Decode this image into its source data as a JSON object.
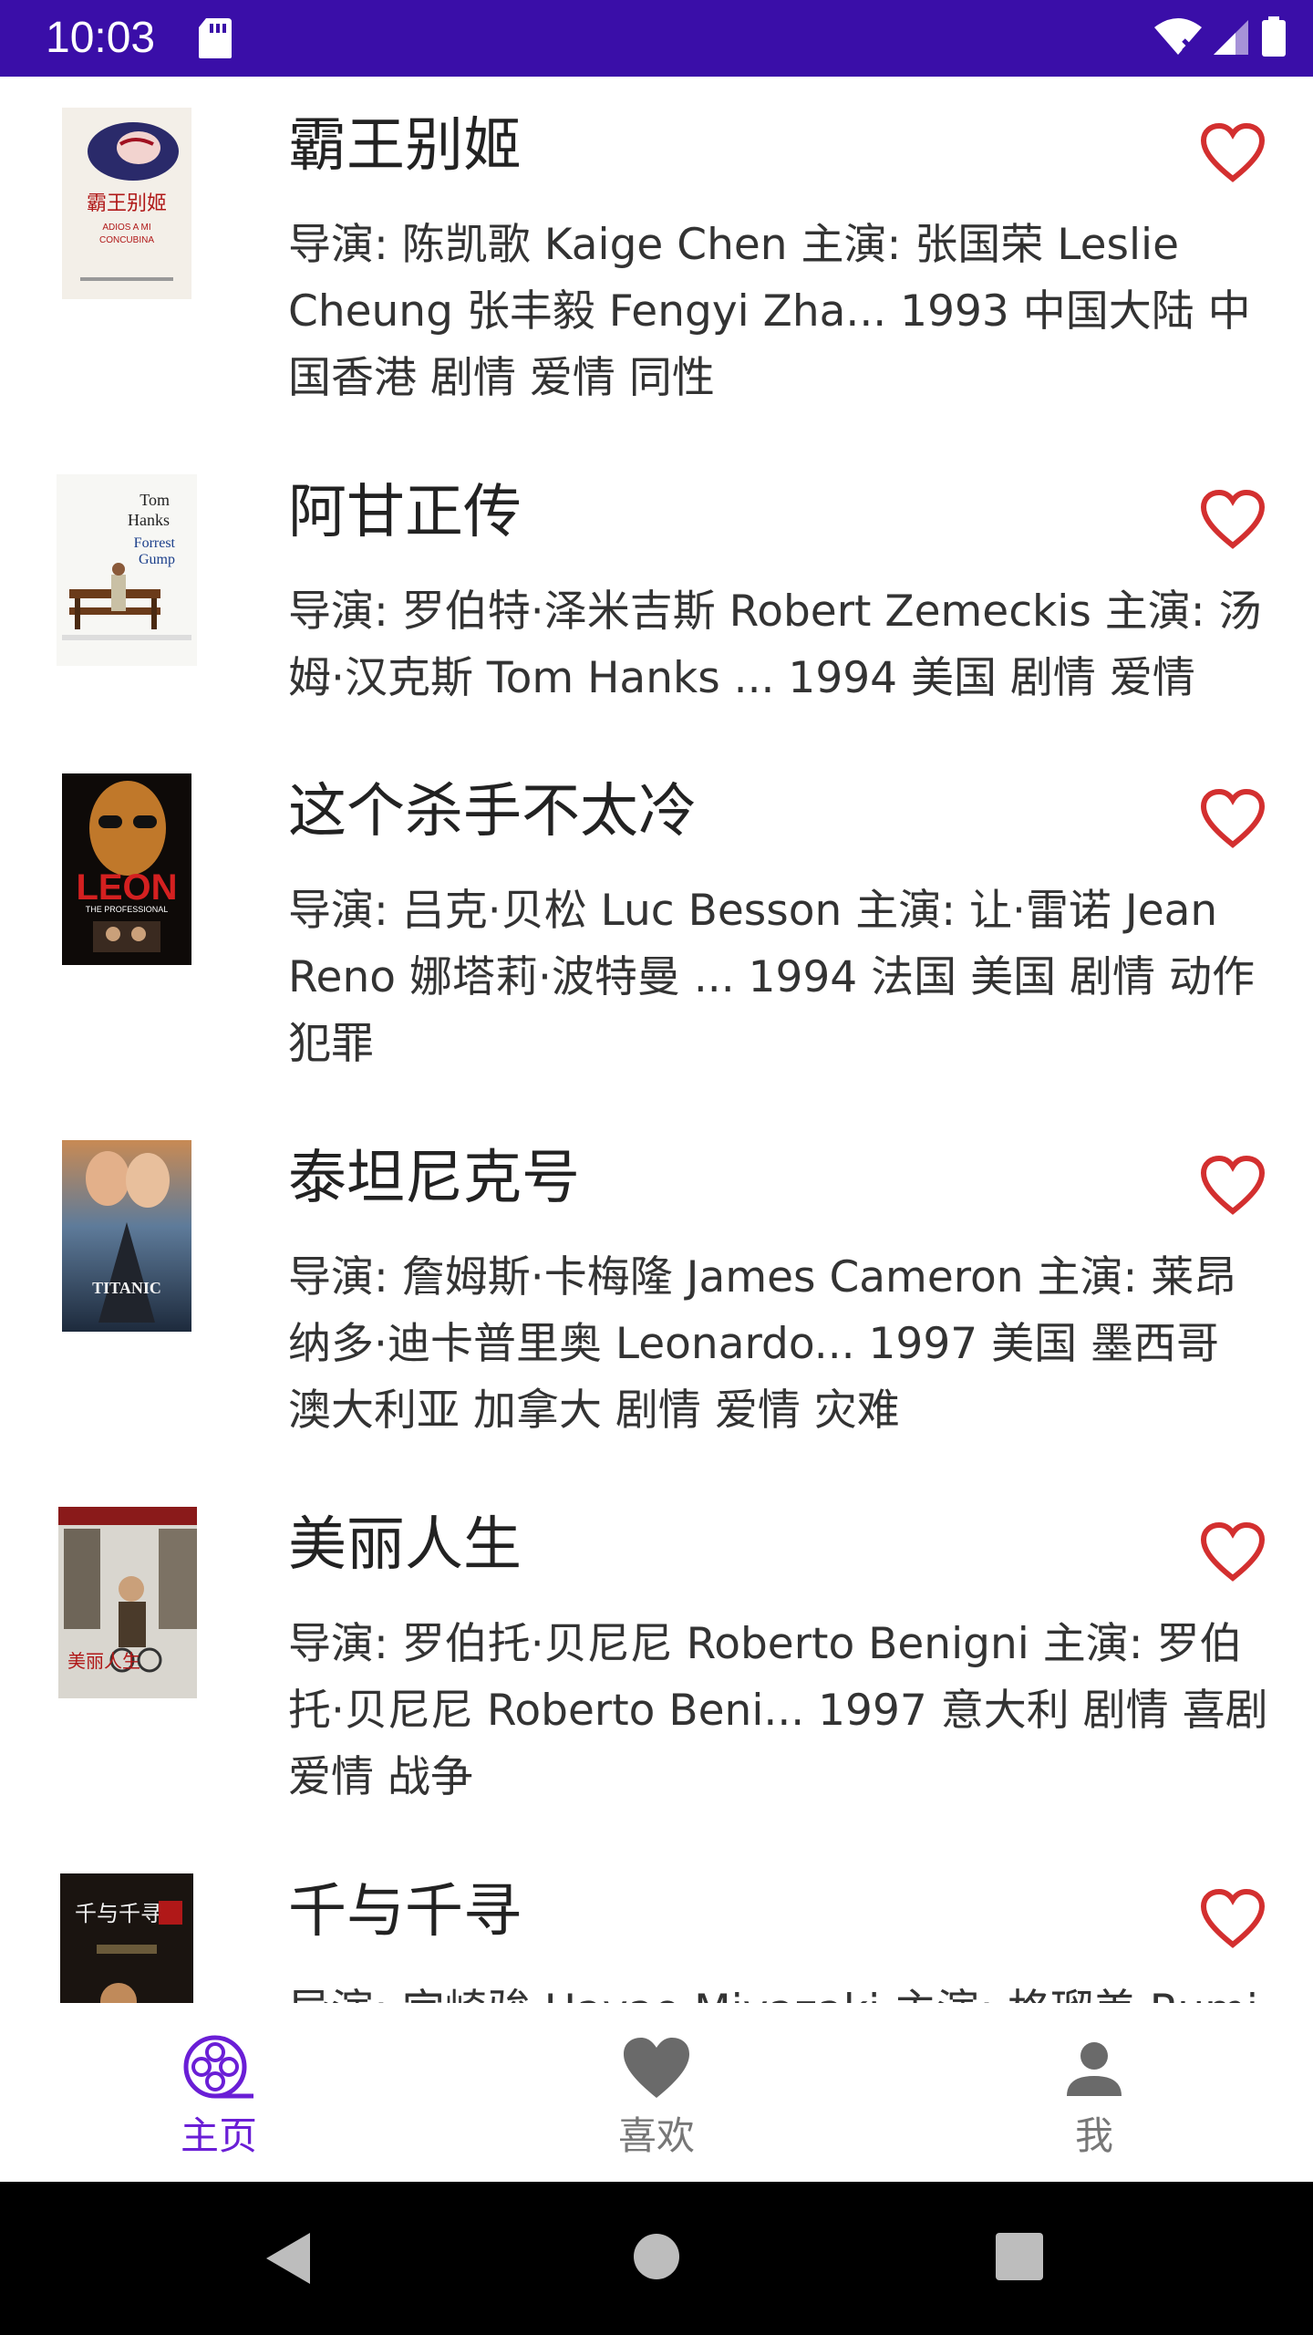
{
  "status_bar": {
    "time": "10:03",
    "icons": [
      "sd-card-icon",
      "wifi-icon",
      "signal-icon",
      "battery-icon"
    ],
    "background": "#3a0ea8"
  },
  "movies": [
    {
      "title": "霸王别姬",
      "desc": "导演: 陈凯歌 Kaige Chen   主演: 张国荣 Leslie Cheung   张丰毅 Fengyi Zha... 1993   中国大陆 中国香港   剧情 爱情 同性",
      "poster_text": "霸王别姬",
      "poster_sub": "ADIOS A MI CONCUBINA"
    },
    {
      "title": "阿甘正传",
      "desc": "导演: 罗伯特·泽米吉斯 Robert Zemeckis   主演: 汤姆·汉克斯 Tom Hanks   ... 1994   美国   剧情 爱情",
      "poster_text": "Tom Hanks is Forrest Gump",
      "poster_sub": ""
    },
    {
      "title": "这个杀手不太冷",
      "desc": "导演: 吕克·贝松 Luc Besson   主演: 让·雷诺 Jean Reno   娜塔莉·波特曼 ... 1994   法国 美国   剧情 动作 犯罪",
      "poster_text": "LEON",
      "poster_sub": "THE PROFESSIONAL"
    },
    {
      "title": "泰坦尼克号",
      "desc": "导演: 詹姆斯·卡梅隆 James Cameron   主演: 莱昂纳多·迪卡普里奥 Leonardo... 1997   美国 墨西哥 澳大利亚 加拿大   剧情 爱情 灾难",
      "poster_text": "TITANIC",
      "poster_sub": ""
    },
    {
      "title": "美丽人生",
      "desc": "导演: 罗伯托·贝尼尼 Roberto Benigni   主演: 罗伯托·贝尼尼 Roberto Beni... 1997   意大利   剧情 喜剧 爱情 战争",
      "poster_text": "美丽人生",
      "poster_sub": ""
    },
    {
      "title": "千与千寻",
      "desc": "导演: 宫崎骏 Hayao Miyazaki   主演: 柊瑠美 Rumi Hîragi",
      "poster_text": "千与千寻",
      "poster_sub": ""
    }
  ],
  "like_icon": "heart-outline-icon",
  "colors": {
    "accent": "#6a1ed6",
    "heart": "#d32f2f",
    "nav_inactive": "#777777"
  },
  "bottom_nav": {
    "items": [
      {
        "label": "主页",
        "icon": "film-reel-icon",
        "active": true
      },
      {
        "label": "喜欢",
        "icon": "heart-filled-icon",
        "active": false
      },
      {
        "label": "我",
        "icon": "person-icon",
        "active": false
      }
    ]
  },
  "system_nav": [
    "back-icon",
    "home-icon",
    "recents-icon"
  ]
}
